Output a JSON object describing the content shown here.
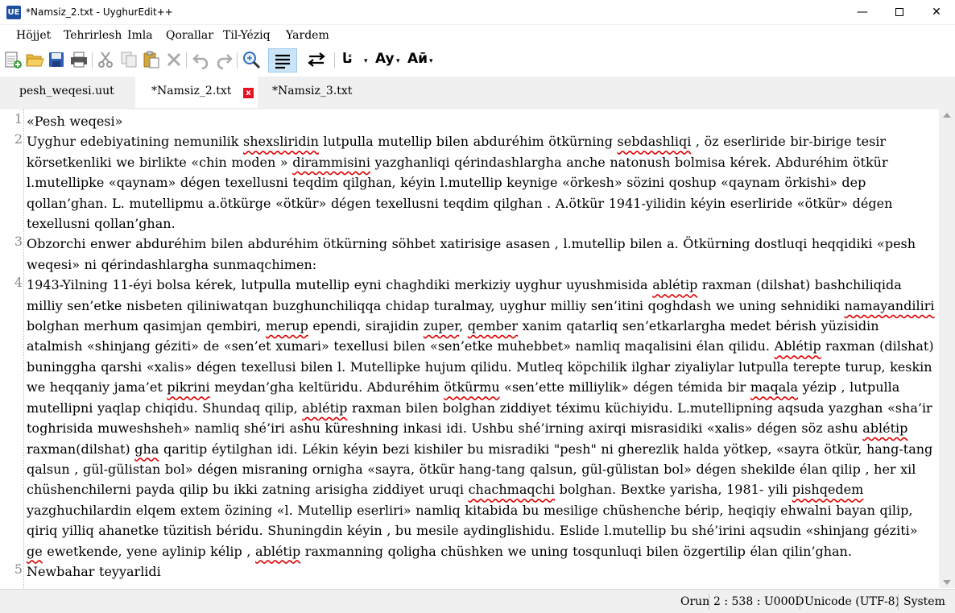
{
  "window": {
    "title": "*Namsiz_2.txt - UyghurEdit++",
    "app_icon_text": "UE",
    "minimize_glyph": "—",
    "close_glyph": "✕"
  },
  "menu": {
    "items": [
      "Höjjet",
      "Tehrirlesh",
      "Imla",
      "Qorallar",
      "Til-Yéziq",
      "Yardem"
    ]
  },
  "toolbar": {
    "font_uyghur_label": "ئا",
    "font_latin_label": "Ay",
    "font_cyrillic_label": "Аӣ",
    "dropdown_glyph": "▾"
  },
  "tabs": [
    {
      "label": "pesh_weqesi.uut",
      "active": false
    },
    {
      "label": "*Namsiz_2.txt",
      "active": true,
      "close": "x"
    },
    {
      "label": "*Namsiz_3.txt",
      "active": false
    }
  ],
  "editor": {
    "line_numbers": [
      "1",
      "2",
      "3",
      "4",
      "5"
    ],
    "lines": [
      [
        {
          "t": "«Pesh weqesi»"
        }
      ],
      [
        {
          "t": "Uyghur edebiyatining nemunilik "
        },
        {
          "t": "shexsliridin",
          "err": true
        },
        {
          "t": " lutpulla mutellip bilen abduréhim ötkürning "
        },
        {
          "t": "sebdashliqi",
          "err": true
        },
        {
          "t": " , öz eserliride bir-birige tesir körsetkenliki we birlikte «chin moden » "
        },
        {
          "t": "dirammisini",
          "err": true
        },
        {
          "t": " yazghanliqi qérindashlargha anche natonush bolmisa kérek. Abduréhim ötkür l.mutellipke «qaynam» dégen texellusni teqdim qilghan, kéyin l.mutellip keynige «örkesh» sözini qoshup «qaynam örkishi» dep qollan’ghan. L. mutellipmu a.ötkürge «ötkür» dégen texellusni teqdim qilghan . A.ötkür 1941-yilidin kéyin eserliride «ötkür» dégen texellusni qollan’ghan."
        }
      ],
      [
        {
          "t": "Obzorchi enwer abduréhim bilen abduréhim ötkürning söhbet xatirisige asasen , l.mutellip bilen a. Ötkürning dostluqi heqqidiki «pesh weqesi» ni qérindashlargha sunmaqchimen:"
        }
      ],
      [
        {
          "t": "1943-Yilning 11-éyi bolsa kérek, lutpulla mutellip eyni chaghdiki merkiziy uyghur uyushmisida "
        },
        {
          "t": "ablétip",
          "err": true
        },
        {
          "t": " raxman (dilshat) bashchiliqida milliy sen’etke nisbeten qiliniwatqan buzghunchiliqqa chidap turalmay, uyghur milliy sen’itini qoghdash we uning sehnidiki "
        },
        {
          "t": "namayandiliri",
          "err": true
        },
        {
          "t": " bolghan merhum qasimjan qembiri, "
        },
        {
          "t": "merup",
          "err": true
        },
        {
          "t": " ependi, sirajidin "
        },
        {
          "t": "zuper",
          "err": true
        },
        {
          "t": ", "
        },
        {
          "t": "qember",
          "err": true
        },
        {
          "t": " xanim qatarliq sen’etkarlargha medet bérish yüzisidin atalmish «shinjang géziti» de «sen’et xumari» texellusi bilen «sen’etke muhebbet» namliq maqalisini élan qilidu. "
        },
        {
          "t": "Ablétip",
          "err": true
        },
        {
          "t": " raxman (dilshat) buninggha qarshi «xalis» dégen texellusi bilen l. Mutellipke hujum qilidu. Mutleq köpchilik ilghar ziyaliylar lutpulla terepte turup, keskin we heqqaniy jama’et "
        },
        {
          "t": "pikrini",
          "err": true
        },
        {
          "t": " meydan’gha keltüridu. Abduréhim "
        },
        {
          "t": "ötkürmu",
          "err": true
        },
        {
          "t": " «sen’ette milliylik» dégen témida bir "
        },
        {
          "t": "maqala",
          "err": true
        },
        {
          "t": " yézip , lutpulla mutellipni yaqlap chiqidu. Shundaq qilip, "
        },
        {
          "t": "ablétip",
          "err": true
        },
        {
          "t": " raxman bilen bolghan ziddiyet téximu küchiyidu. L.mutellipning aqsuda yazghan «sha’ir toghrisida muweshsheh» namliq shé’iri ashu küreshning inkasi idi. Ushbu shé’irning axirqi misrasidiki «xalis» dégen söz ashu "
        },
        {
          "t": "ablétip",
          "err": true
        },
        {
          "t": " raxman(dilshat) "
        },
        {
          "t": "gha",
          "err": true
        },
        {
          "t": " qaritip éytilghan idi. Lékin kéyin bezi kishiler bu misradiki \"pesh\" ni gherezlik halda yötkep, «sayra ötkür, hang-tang qalsun , gül-gülistan bol» dégen misraning ornigha «sayra, ötkür hang-tang qalsun, gül-gülistan bol» dégen shekilde élan qilip , her xil chüshenchilerni payda qilip bu ikki zatning arisigha ziddiyet uruqi "
        },
        {
          "t": "chachmaqchi",
          "err": true
        },
        {
          "t": " bolghan. Bextke yarisha, 1981- yili "
        },
        {
          "t": "pishqedem",
          "err": true
        },
        {
          "t": " yazghuchilardin elqem extem özining «l. Mutellip eserliri» namliq kitabida bu mesilige chüshenche bérip, heqiqiy ehwalni bayan qilip, qiriq yilliq ahanetke tüzitish béridu. Shuningdin kéyin , bu mesile aydinglishidu. Eslide l.mutellip bu shé’irini aqsudin «shinjang géziti» "
        },
        {
          "t": "ge",
          "err": true
        },
        {
          "t": " ewetkende, yene aylinip kélip , "
        },
        {
          "t": "ablétip",
          "err": true
        },
        {
          "t": " raxmanning qoligha chüshken we uning tosqunluqi bilen özgertilip élan qilin’ghan."
        }
      ],
      [
        {
          "t": "Newbahar teyyarlidi"
        }
      ]
    ]
  },
  "status": {
    "mode": "Orun",
    "position": "2 : 538 : U000D",
    "encoding": "Unicode (UTF-8)",
    "line_ending": "System"
  }
}
